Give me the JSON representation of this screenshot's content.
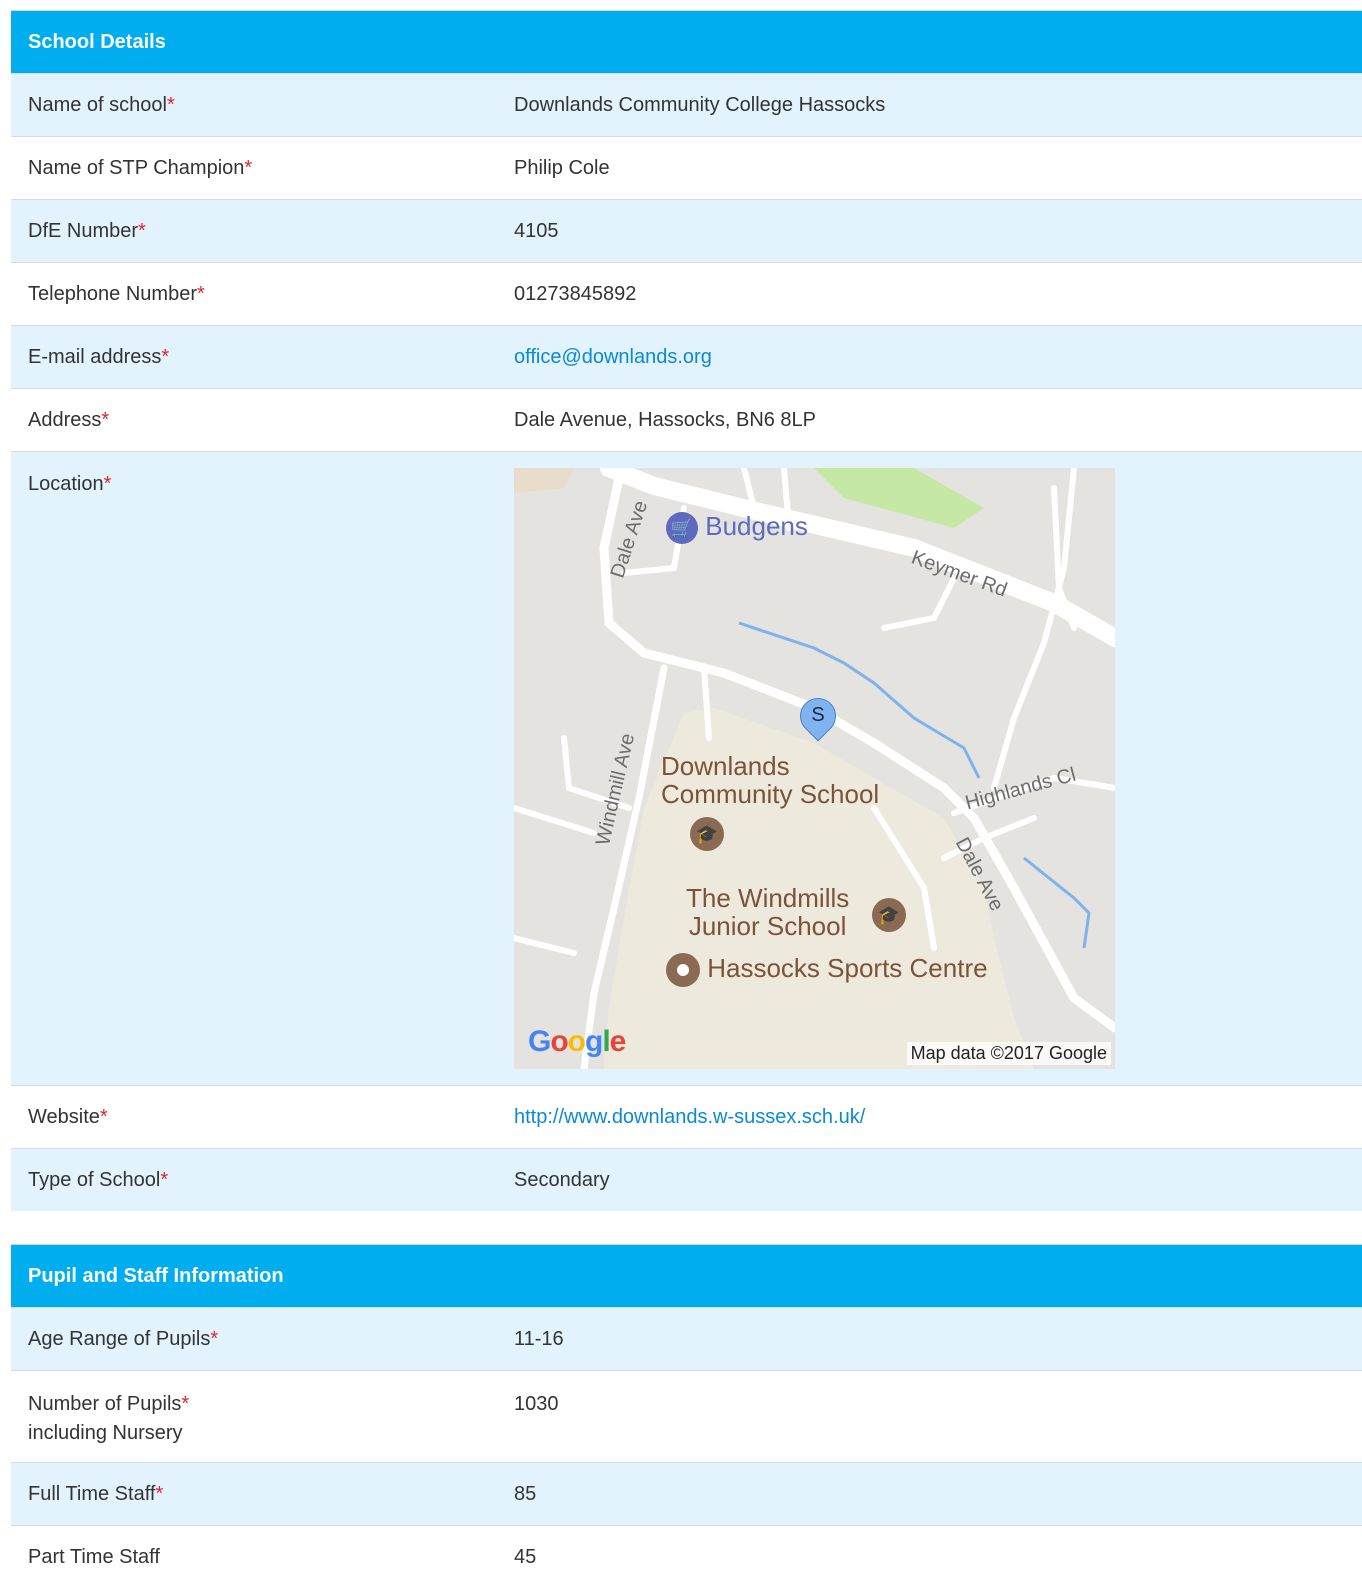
{
  "school_details": {
    "heading": "School Details",
    "required_marker": "*",
    "name_label": "Name of school",
    "name_value": "Downlands Community College Hassocks",
    "champion_label": "Name of STP Champion",
    "champion_value": "Philip Cole",
    "dfe_label": "DfE Number",
    "dfe_value": "4105",
    "phone_label": "Telephone Number",
    "phone_value": "01273845892",
    "email_label": "E-mail address",
    "email_value": "office@downlands.org",
    "address_label": "Address",
    "address_value": "Dale Avenue, Hassocks, BN6 8LP",
    "location_label": "Location",
    "website_label": "Website",
    "website_value": "http://www.downlands.w-sussex.sch.uk/",
    "type_label": "Type of School",
    "type_value": "Secondary"
  },
  "map": {
    "marker_letter": "S",
    "poi_budgens": "Budgens",
    "poi_school_line1": "Downlands",
    "poi_school_line2": "Community School",
    "poi_junior_line1": "The Windmills",
    "poi_junior_line2": "Junior School",
    "poi_sports": "Hassocks Sports Centre",
    "street_dale_ave_top": "Dale Ave",
    "street_keymer": "Keymer Rd",
    "street_windmill": "Windmill Ave",
    "street_highlands": "Highlands Cl",
    "street_dale_ave_right": "Dale Ave",
    "logo": [
      "G",
      "o",
      "o",
      "g",
      "l",
      "e"
    ],
    "credit": "Map data ©2017 Google",
    "colors": {
      "land": "#e5e3df",
      "park": "#c5e8a5",
      "school_area": "#ede9dd",
      "water": "#7fb2ec",
      "poi_brown": "#7b5438"
    }
  },
  "pupil_staff": {
    "heading": "Pupil and Staff Information",
    "age_label": "Age Range of Pupils",
    "age_value": "11-16",
    "pupils_label": "Number of Pupils",
    "pupils_sublabel": "including Nursery",
    "pupils_value": "1030",
    "fulltime_label": "Full Time Staff",
    "fulltime_value": "85",
    "parttime_label": "Part Time Staff",
    "parttime_value": "45"
  },
  "colors": {
    "header_bg": "#00adee",
    "row_shade": "#e2f3fd",
    "required": "#e0242c",
    "link": "#0a8ad6"
  }
}
